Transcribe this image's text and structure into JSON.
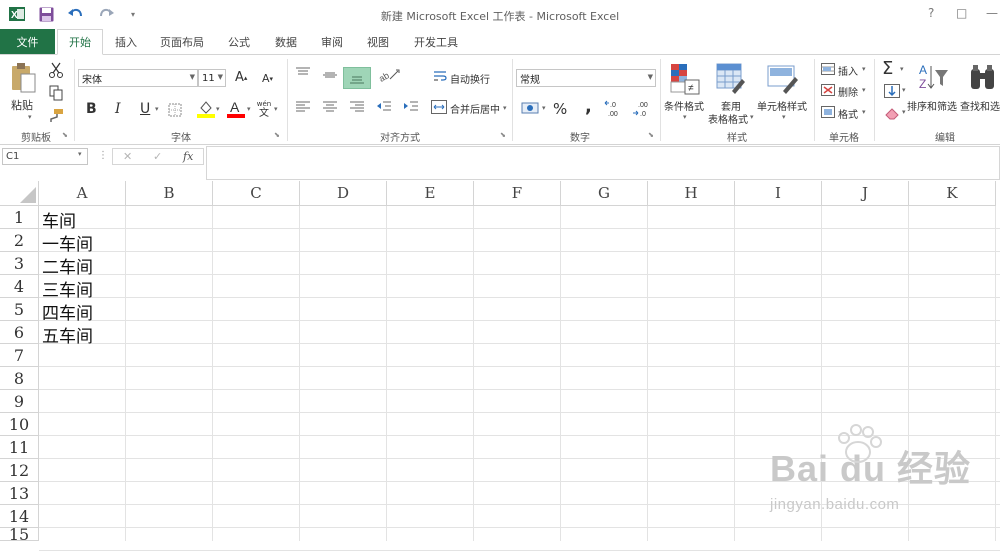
{
  "titlebar": {
    "title": "新建 Microsoft Excel 工作表 - Microsoft Excel",
    "help": "?",
    "restore": "□",
    "minimize": "—"
  },
  "tabs": {
    "file": "文件",
    "items": [
      "开始",
      "插入",
      "页面布局",
      "公式",
      "数据",
      "审阅",
      "视图",
      "开发工具"
    ]
  },
  "ribbon": {
    "clipboard": {
      "paste": "粘贴",
      "label": "剪贴板"
    },
    "font": {
      "name": "宋体",
      "size": "11",
      "label": "字体",
      "bold": "B",
      "italic": "I",
      "underline": "U",
      "grow": "A",
      "shrink": "A",
      "wen": "wén",
      "wen2": "文"
    },
    "alignment": {
      "wrap": "自动换行",
      "merge": "合并后居中",
      "label": "对齐方式"
    },
    "number": {
      "format": "常规",
      "percent": "%",
      "comma": ",",
      "inc_decimal": ".0\n.00",
      "dec_decimal": ".00\n→.0",
      "label": "数字"
    },
    "styles": {
      "conditional": "条件格式",
      "table_line1": "套用",
      "table_line2": "表格格式",
      "cell_styles": "单元格样式",
      "label": "样式"
    },
    "cells": {
      "insert": "插入",
      "delete": "删除",
      "format": "格式",
      "label": "单元格"
    },
    "editing": {
      "sort": "排序和筛选",
      "find": "查找和选择",
      "label": "编辑",
      "sigma": "Σ"
    }
  },
  "formula": {
    "namebox": "C1",
    "cancel": "✕",
    "enter": "✓",
    "fx": "fx",
    "content": ""
  },
  "columns": [
    "A",
    "B",
    "C",
    "D",
    "E",
    "F",
    "G",
    "H",
    "I",
    "J",
    "K"
  ],
  "rows": [
    "1",
    "2",
    "3",
    "4",
    "5",
    "6",
    "7",
    "8",
    "9",
    "10",
    "11",
    "12",
    "13",
    "14",
    "15"
  ],
  "cells": {
    "A1": "车间",
    "A2": "一车间",
    "A3": "二车间",
    "A4": "三车间",
    "A5": "四车间",
    "A6": "五车间"
  },
  "watermark": {
    "brand": "Bai du 经验",
    "url": "jingyan.baidu.com"
  },
  "colors": {
    "excel_green": "#217346",
    "accent_yellow": "#ffff00",
    "accent_red": "#ff0000"
  }
}
